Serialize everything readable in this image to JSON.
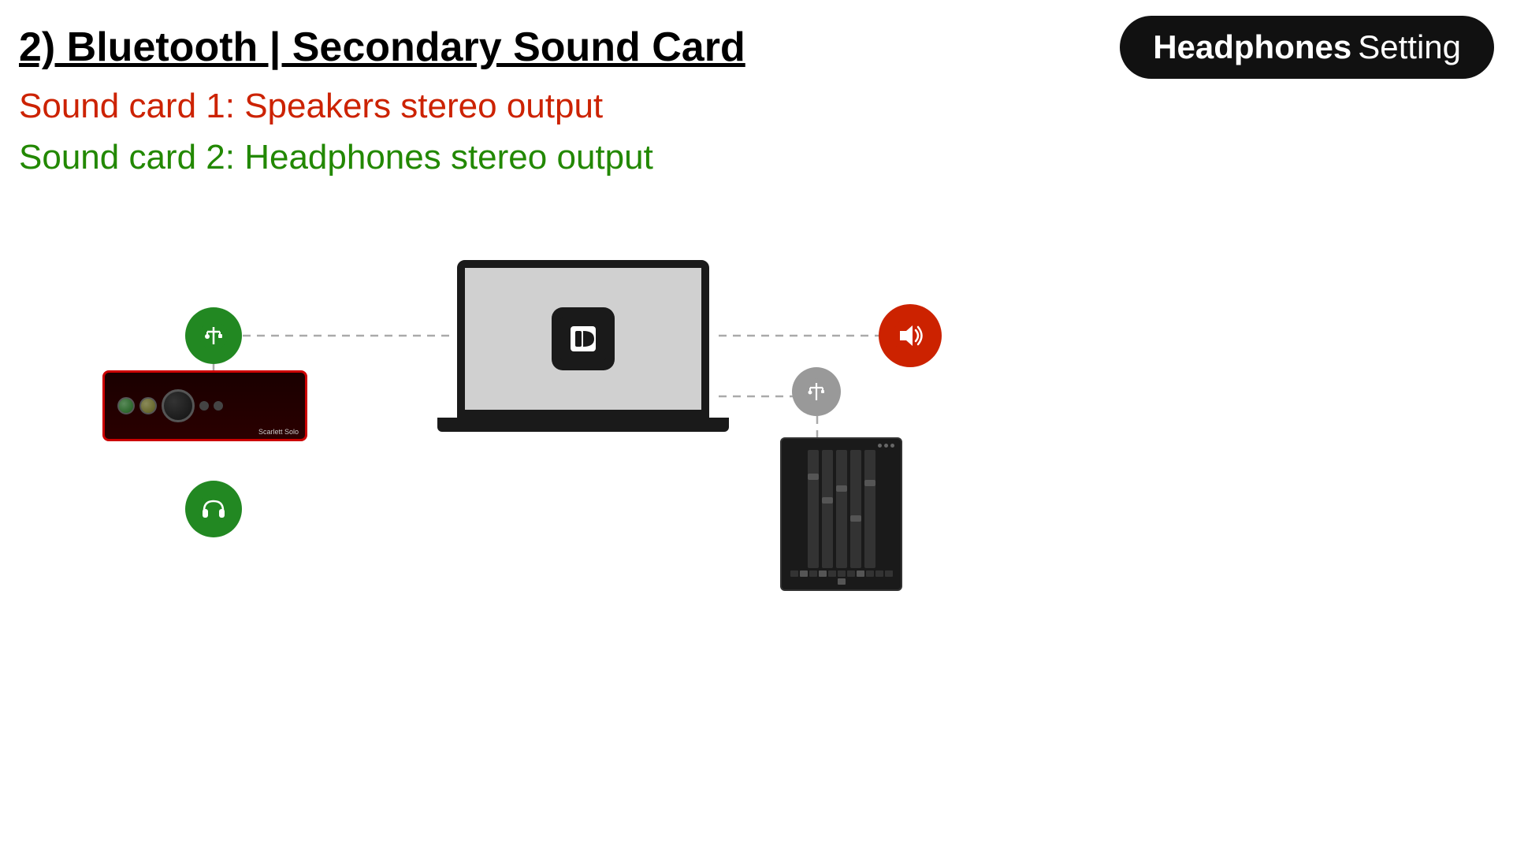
{
  "header": {
    "title": "2) Bluetooth | Secondary Sound Card",
    "badge": {
      "bold": "Headphones",
      "normal": " Setting"
    }
  },
  "subtitles": {
    "line1": "Sound card 1: Speakers stereo output",
    "line2": "Sound card 2: Headphones stereo output"
  },
  "diagram": {
    "usb_icon": "⊕",
    "headphone_icon": "🎧",
    "speaker_icon": "🔊",
    "dj_logo": "DJ"
  },
  "colors": {
    "green": "#228822",
    "red": "#cc2200",
    "gray": "#999999",
    "black": "#111111"
  }
}
